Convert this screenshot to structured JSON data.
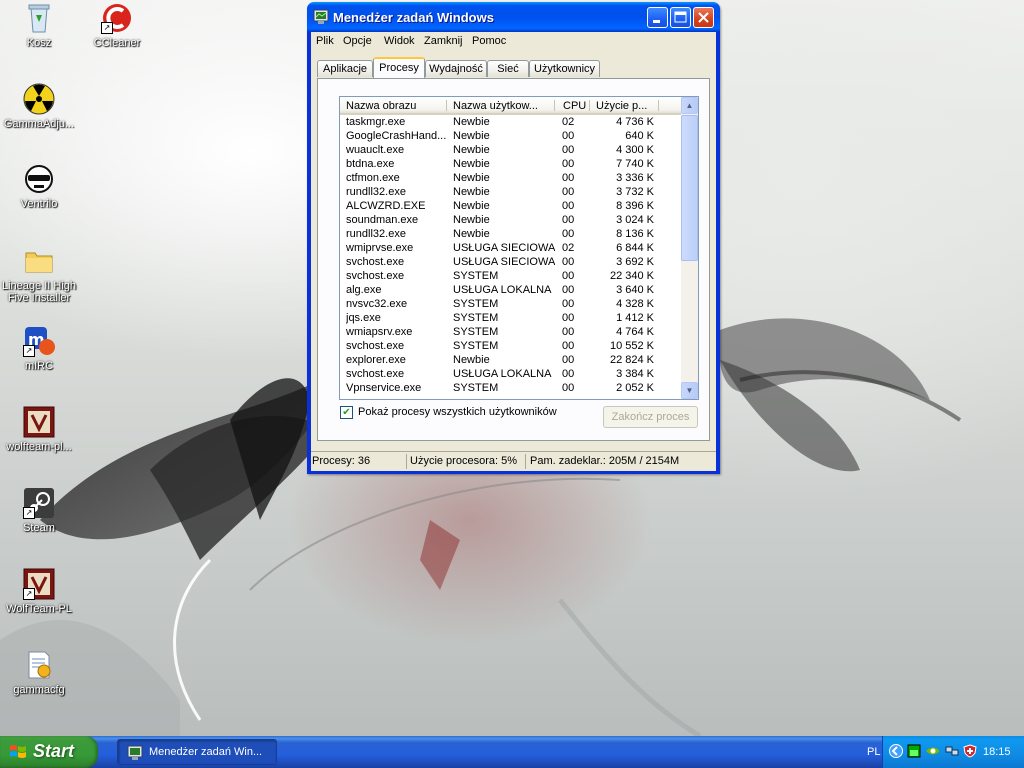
{
  "desktop": {
    "icons": [
      {
        "label": "Kosz"
      },
      {
        "label": "CCleaner"
      },
      {
        "label": "GammaAdju..."
      },
      {
        "label": "Ventrilo"
      },
      {
        "label": "Lineage II High Five Installer"
      },
      {
        "label": "mIRC"
      },
      {
        "label": "wolfteam-pl..."
      },
      {
        "label": "Steam"
      },
      {
        "label": "WolfTeam-PL"
      },
      {
        "label": "gammacfg"
      }
    ]
  },
  "window": {
    "title": "Menedżer zadań Windows",
    "menu": [
      "Plik",
      "Opcje",
      "Widok",
      "Zamknij",
      "Pomoc"
    ],
    "tabs": [
      "Aplikacje",
      "Procesy",
      "Wydajność",
      "Sieć",
      "Użytkownicy"
    ],
    "active_tab": "Procesy",
    "columns": [
      "Nazwa obrazu",
      "Nazwa użytkow...",
      "CPU",
      "Użycie p..."
    ],
    "processes": [
      {
        "name": "taskmgr.exe",
        "user": "Newbie",
        "cpu": "02",
        "mem": "4 736 K"
      },
      {
        "name": "GoogleCrashHand...",
        "user": "Newbie",
        "cpu": "00",
        "mem": "640 K"
      },
      {
        "name": "wuauclt.exe",
        "user": "Newbie",
        "cpu": "00",
        "mem": "4 300 K"
      },
      {
        "name": "btdna.exe",
        "user": "Newbie",
        "cpu": "00",
        "mem": "7 740 K"
      },
      {
        "name": "ctfmon.exe",
        "user": "Newbie",
        "cpu": "00",
        "mem": "3 336 K"
      },
      {
        "name": "rundll32.exe",
        "user": "Newbie",
        "cpu": "00",
        "mem": "3 732 K"
      },
      {
        "name": "ALCWZRD.EXE",
        "user": "Newbie",
        "cpu": "00",
        "mem": "8 396 K"
      },
      {
        "name": "soundman.exe",
        "user": "Newbie",
        "cpu": "00",
        "mem": "3 024 K"
      },
      {
        "name": "rundll32.exe",
        "user": "Newbie",
        "cpu": "00",
        "mem": "8 136 K"
      },
      {
        "name": "wmiprvse.exe",
        "user": "USŁUGA SIECIOWA",
        "cpu": "02",
        "mem": "6 844 K"
      },
      {
        "name": "svchost.exe",
        "user": "USŁUGA SIECIOWA",
        "cpu": "00",
        "mem": "3 692 K"
      },
      {
        "name": "svchost.exe",
        "user": "SYSTEM",
        "cpu": "00",
        "mem": "22 340 K"
      },
      {
        "name": "alg.exe",
        "user": "USŁUGA LOKALNA",
        "cpu": "00",
        "mem": "3 640 K"
      },
      {
        "name": "nvsvc32.exe",
        "user": "SYSTEM",
        "cpu": "00",
        "mem": "4 328 K"
      },
      {
        "name": "jqs.exe",
        "user": "SYSTEM",
        "cpu": "00",
        "mem": "1 412 K"
      },
      {
        "name": "wmiapsrv.exe",
        "user": "SYSTEM",
        "cpu": "00",
        "mem": "4 764 K"
      },
      {
        "name": "svchost.exe",
        "user": "SYSTEM",
        "cpu": "00",
        "mem": "10 552 K"
      },
      {
        "name": "explorer.exe",
        "user": "Newbie",
        "cpu": "00",
        "mem": "22 824 K"
      },
      {
        "name": "svchost.exe",
        "user": "USŁUGA LOKALNA",
        "cpu": "00",
        "mem": "3 384 K"
      },
      {
        "name": "Vpnservice.exe",
        "user": "SYSTEM",
        "cpu": "00",
        "mem": "2 052 K"
      }
    ],
    "show_all_label": "Pokaż procesy wszystkich użytkowników",
    "show_all_checked": true,
    "end_process_label": "Zakończ proces",
    "status": {
      "processes": "Procesy: 36",
      "cpu": "Użycie procesora: 5%",
      "commit": "Pam. zadeklar.: 205M / 2154M"
    }
  },
  "taskbar": {
    "start_label": "Start",
    "task_button_label": "Menedżer zadań Win...",
    "language": "PL",
    "clock": "18:15"
  },
  "colors": {
    "title_blue": "#0054e3",
    "start_green": "#3c9a3b",
    "tray_blue": "#0f8be3"
  }
}
